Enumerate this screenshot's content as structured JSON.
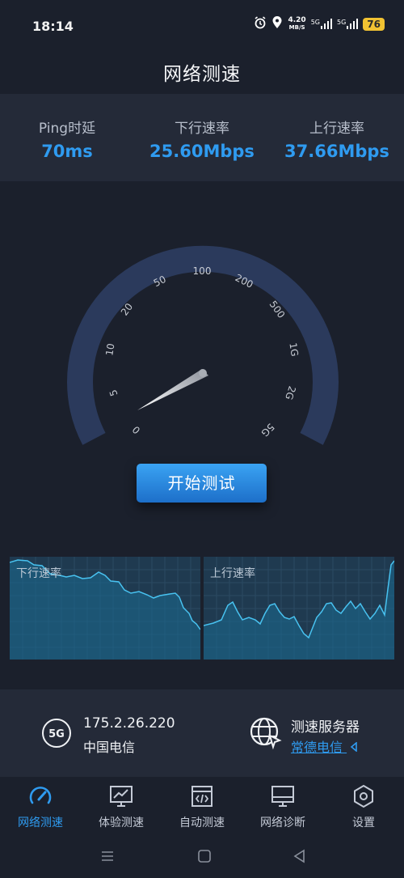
{
  "status_bar": {
    "time": "18:14",
    "net_speed_value": "4.20",
    "net_speed_unit": "MB/S",
    "signal1_label": "5G",
    "signal2_label": "5G",
    "battery": "76",
    "icons": [
      "alarm-icon",
      "location-icon",
      "signal-icon",
      "signal-icon",
      "battery-icon"
    ]
  },
  "header": {
    "title": "网络测速"
  },
  "stats": [
    {
      "label": "Ping时延",
      "value": "70ms"
    },
    {
      "label": "下行速率",
      "value": "25.60Mbps"
    },
    {
      "label": "上行速率",
      "value": "37.66Mbps"
    }
  ],
  "gauge": {
    "tick_labels": [
      "0",
      "5",
      "10",
      "20",
      "50",
      "100",
      "200",
      "500",
      "1G",
      "2G",
      "5G"
    ]
  },
  "actions": {
    "start_label": "开始测试"
  },
  "charts": {
    "download_label": "下行速率",
    "upload_label": "上行速率"
  },
  "connection": {
    "network_badge": "5G",
    "ip": "175.2.26.220",
    "carrier": "中国电信",
    "server_title": "测速服务器",
    "server_name": "常德电信"
  },
  "nav": {
    "items": [
      {
        "label": "网络测速",
        "icon": "speedometer-icon",
        "active": true
      },
      {
        "label": "体验测速",
        "icon": "chart-monitor-icon",
        "active": false
      },
      {
        "label": "自动测速",
        "icon": "code-window-icon",
        "active": false
      },
      {
        "label": "网络诊断",
        "icon": "monitor-icon",
        "active": false
      },
      {
        "label": "设置",
        "icon": "settings-hexagon-icon",
        "active": false
      }
    ]
  },
  "colors": {
    "accent": "#2f9bf0",
    "background": "#1b202c",
    "panel": "#242a38",
    "gauge_arc": "#2b3a5c"
  }
}
